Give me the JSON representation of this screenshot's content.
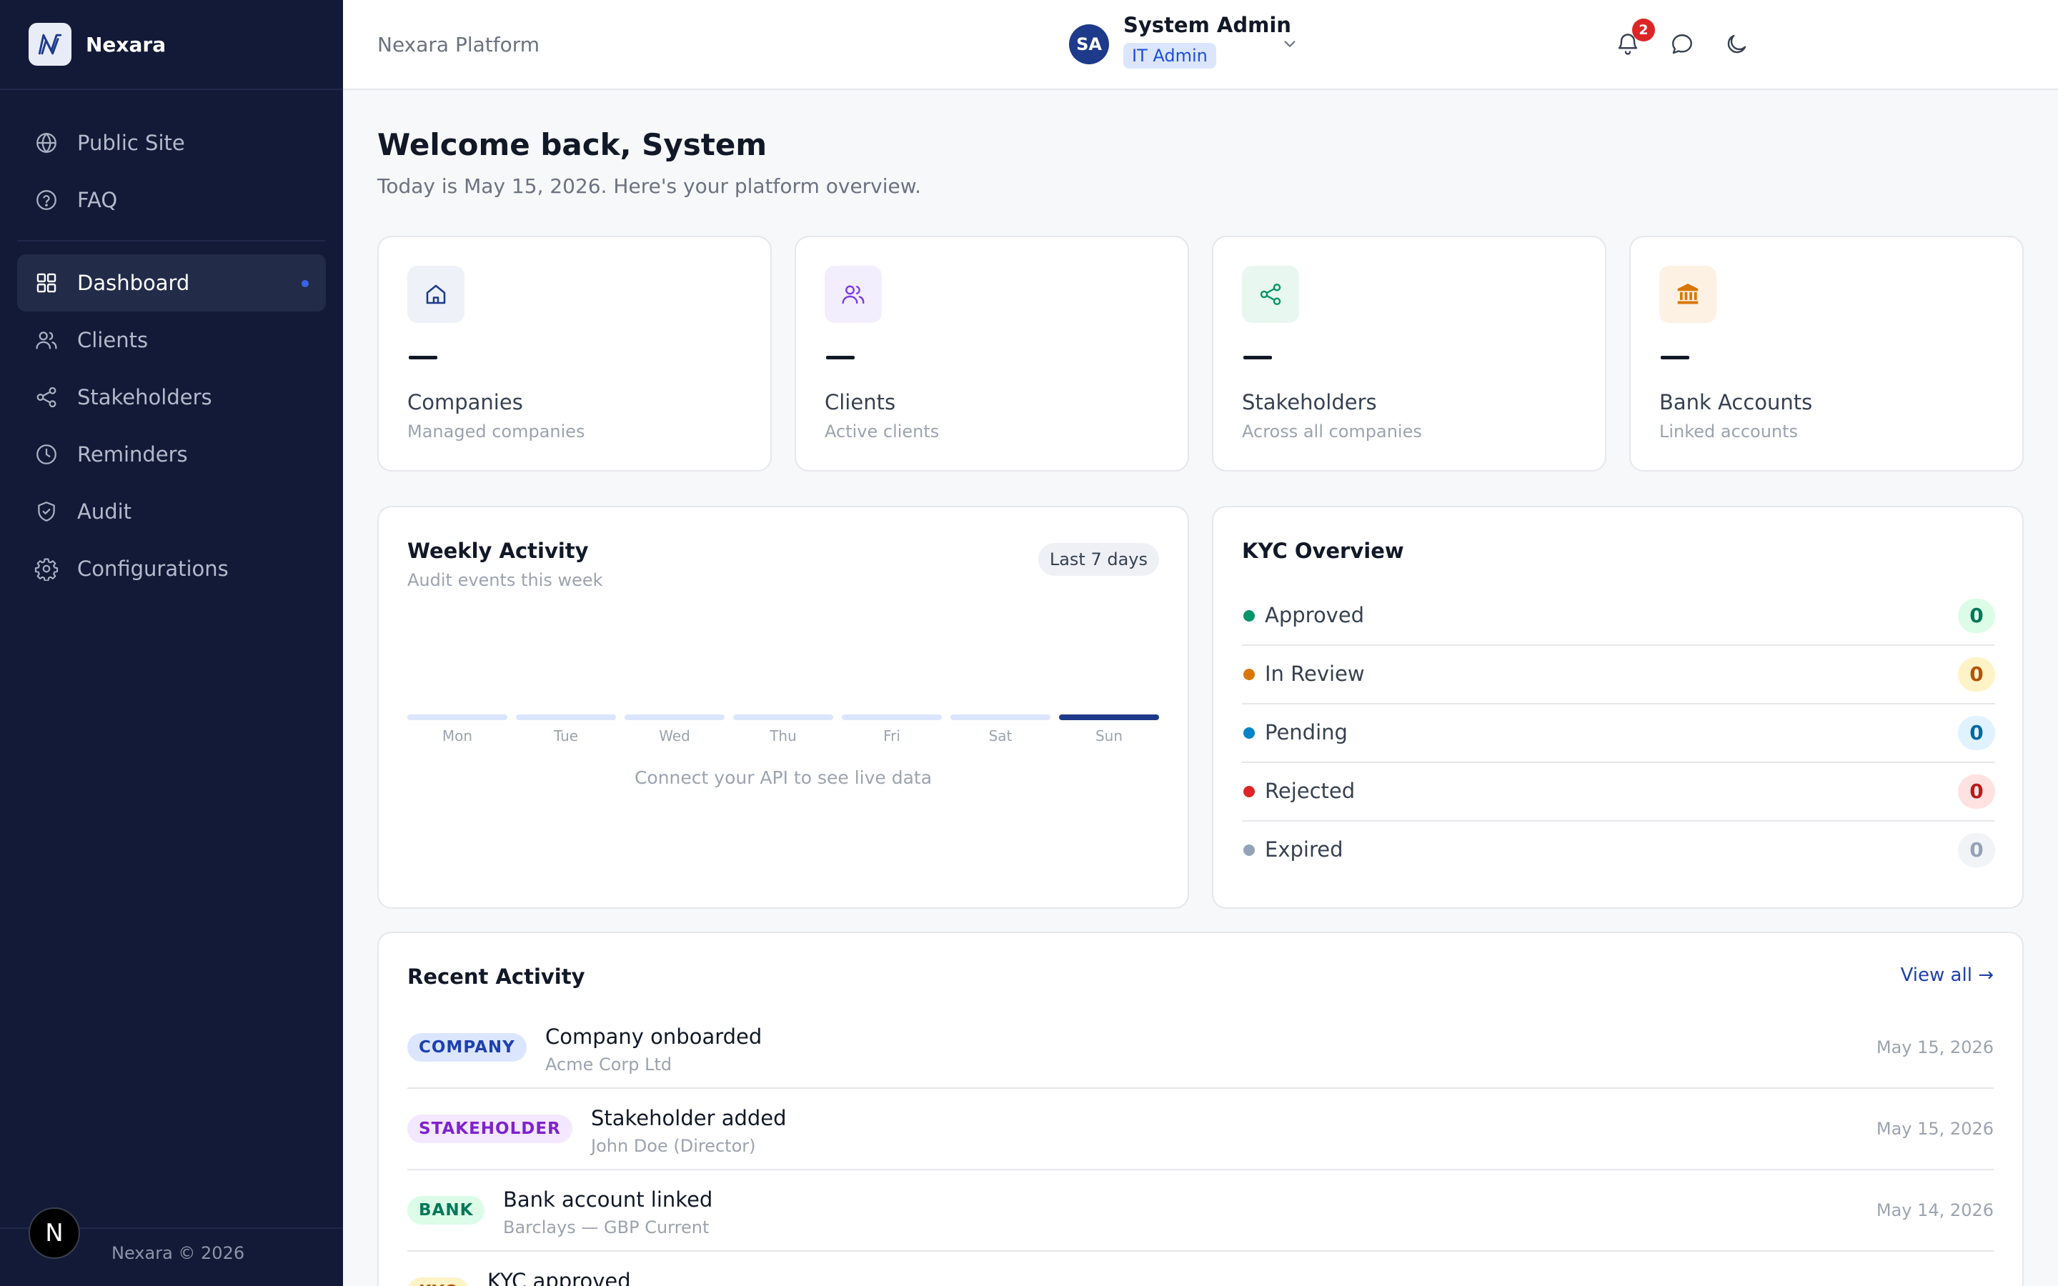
{
  "app": {
    "name": "Nexara",
    "footer": "Nexara © 2026",
    "badge_letter": "N"
  },
  "sidebar": {
    "top_items": [
      {
        "label": "Public Site",
        "icon": "globe-icon"
      },
      {
        "label": "FAQ",
        "icon": "help-circle-icon"
      }
    ],
    "items": [
      {
        "label": "Dashboard",
        "icon": "grid-icon",
        "active": true
      },
      {
        "label": "Clients",
        "icon": "users-icon"
      },
      {
        "label": "Stakeholders",
        "icon": "share-icon"
      },
      {
        "label": "Reminders",
        "icon": "clock-icon"
      },
      {
        "label": "Audit",
        "icon": "shield-check-icon"
      },
      {
        "label": "Configurations",
        "icon": "gear-icon"
      }
    ]
  },
  "header": {
    "title": "Nexara Platform",
    "notification_count": "2",
    "user": {
      "initials": "SA",
      "name": "System Admin",
      "role": "IT Admin"
    }
  },
  "main": {
    "welcome": "Welcome back, System",
    "subtitle": "Today is May 15, 2026. Here's your platform overview.",
    "stats": [
      {
        "label": "Companies",
        "desc": "Managed companies",
        "icon": "home-icon",
        "color": "#1e3a8a",
        "bg": "#eef1f8"
      },
      {
        "label": "Clients",
        "desc": "Active clients",
        "icon": "users-icon",
        "color": "#7c3aed",
        "bg": "#f3eefd"
      },
      {
        "label": "Stakeholders",
        "desc": "Across all companies",
        "icon": "share-icon",
        "color": "#059669",
        "bg": "#e8f7f0"
      },
      {
        "label": "Bank Accounts",
        "desc": "Linked accounts",
        "icon": "bank-icon",
        "color": "#d97706",
        "bg": "#fdf1e4"
      }
    ],
    "weekly": {
      "title": "Weekly Activity",
      "subtitle": "Audit events this week",
      "range": "Last 7 days",
      "days": [
        "Mon",
        "Tue",
        "Wed",
        "Thu",
        "Fri",
        "Sat",
        "Sun"
      ],
      "note": "Connect your API to see live data"
    },
    "kyc": {
      "title": "KYC Overview",
      "rows": [
        {
          "label": "Approved",
          "count": "0",
          "dot": "#059669",
          "fg": "#047857",
          "bg": "#dcfce7"
        },
        {
          "label": "In Review",
          "count": "0",
          "dot": "#d97706",
          "fg": "#b45309",
          "bg": "#fef3c7"
        },
        {
          "label": "Pending",
          "count": "0",
          "dot": "#0284c7",
          "fg": "#0369a1",
          "bg": "#e0f2fe"
        },
        {
          "label": "Rejected",
          "count": "0",
          "dot": "#dc2626",
          "fg": "#b91c1c",
          "bg": "#fee2e2"
        },
        {
          "label": "Expired",
          "count": "0",
          "dot": "#94a3b8",
          "fg": "#94a3b8",
          "bg": "#f1f3f6"
        }
      ]
    },
    "activity": {
      "title": "Recent Activity",
      "view_all": "View all →",
      "rows": [
        {
          "tag": "COMPANY",
          "title": "Company onboarded",
          "detail": "Acme Corp Ltd",
          "date": "May 15, 2026",
          "fg": "#1e40af",
          "bg": "#dbe6fe"
        },
        {
          "tag": "STAKEHOLDER",
          "title": "Stakeholder added",
          "detail": "John Doe (Director)",
          "date": "May 15, 2026",
          "fg": "#7e22ce",
          "bg": "#f3e8ff"
        },
        {
          "tag": "BANK",
          "title": "Bank account linked",
          "detail": "Barclays — GBP Current",
          "date": "May 14, 2026",
          "fg": "#047857",
          "bg": "#dcfce7"
        },
        {
          "tag": "KYC",
          "title": "KYC approved",
          "detail": "",
          "date": "",
          "fg": "#b45309",
          "bg": "#fef3c7"
        }
      ]
    }
  }
}
